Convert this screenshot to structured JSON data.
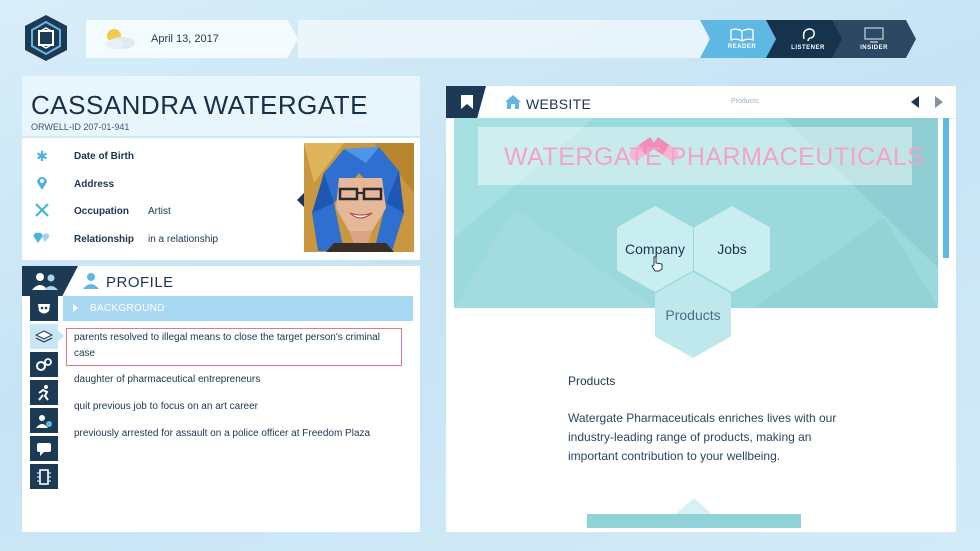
{
  "topbar": {
    "date": "April 13, 2017",
    "weather_icon": "partly-cloudy-icon",
    "modes": [
      {
        "label": "READER",
        "icon": "book-icon",
        "active": true
      },
      {
        "label": "LISTENER",
        "icon": "ear-icon",
        "active": false
      },
      {
        "label": "INSIDER",
        "icon": "computer-icon",
        "active": false
      }
    ]
  },
  "person": {
    "name": "CASSANDRA WATERGATE",
    "orwell_id": "ORWELL-ID  207-01-941",
    "fields": [
      {
        "key": "Date of Birth",
        "value": "",
        "icon": "asterisk-icon"
      },
      {
        "key": "Address",
        "value": "",
        "icon": "location-pin-icon"
      },
      {
        "key": "Occupation",
        "value": "Artist",
        "icon": "tools-icon"
      },
      {
        "key": "Relationship",
        "value": "in a relationship",
        "icon": "hearts-icon"
      }
    ]
  },
  "profile": {
    "title": "PROFILE",
    "section_label": "BACKGROUND",
    "entries": [
      "parents resolved to illegal means to close the target person's criminal case",
      "daughter of pharmaceutical entrepreneurs",
      "quit previous job to focus on an art career",
      "previously arrested for assault on a police officer at Freedom Plaza"
    ],
    "side_icons": [
      "mask-icon",
      "layers-icon",
      "gears-icon",
      "running-person-icon",
      "person-info-icon",
      "chat-icon",
      "memory-chip-icon"
    ]
  },
  "website": {
    "title": "WEBSITE",
    "url": "Products",
    "site_title": "WATERGATE PHARMACEUTICALS",
    "nav": {
      "company": "Company",
      "jobs": "Jobs",
      "products": "Products"
    },
    "products_heading": "Products",
    "products_desc": "Watergate Pharmaceuticals enriches lives with our industry-leading range of products, making an important contribution to your wellbeing."
  },
  "colors": {
    "navy": "#1d3a55",
    "accent": "#5fb7e3",
    "site_pink": "#f3a3c7",
    "site_teal": "#9ad9dc"
  }
}
